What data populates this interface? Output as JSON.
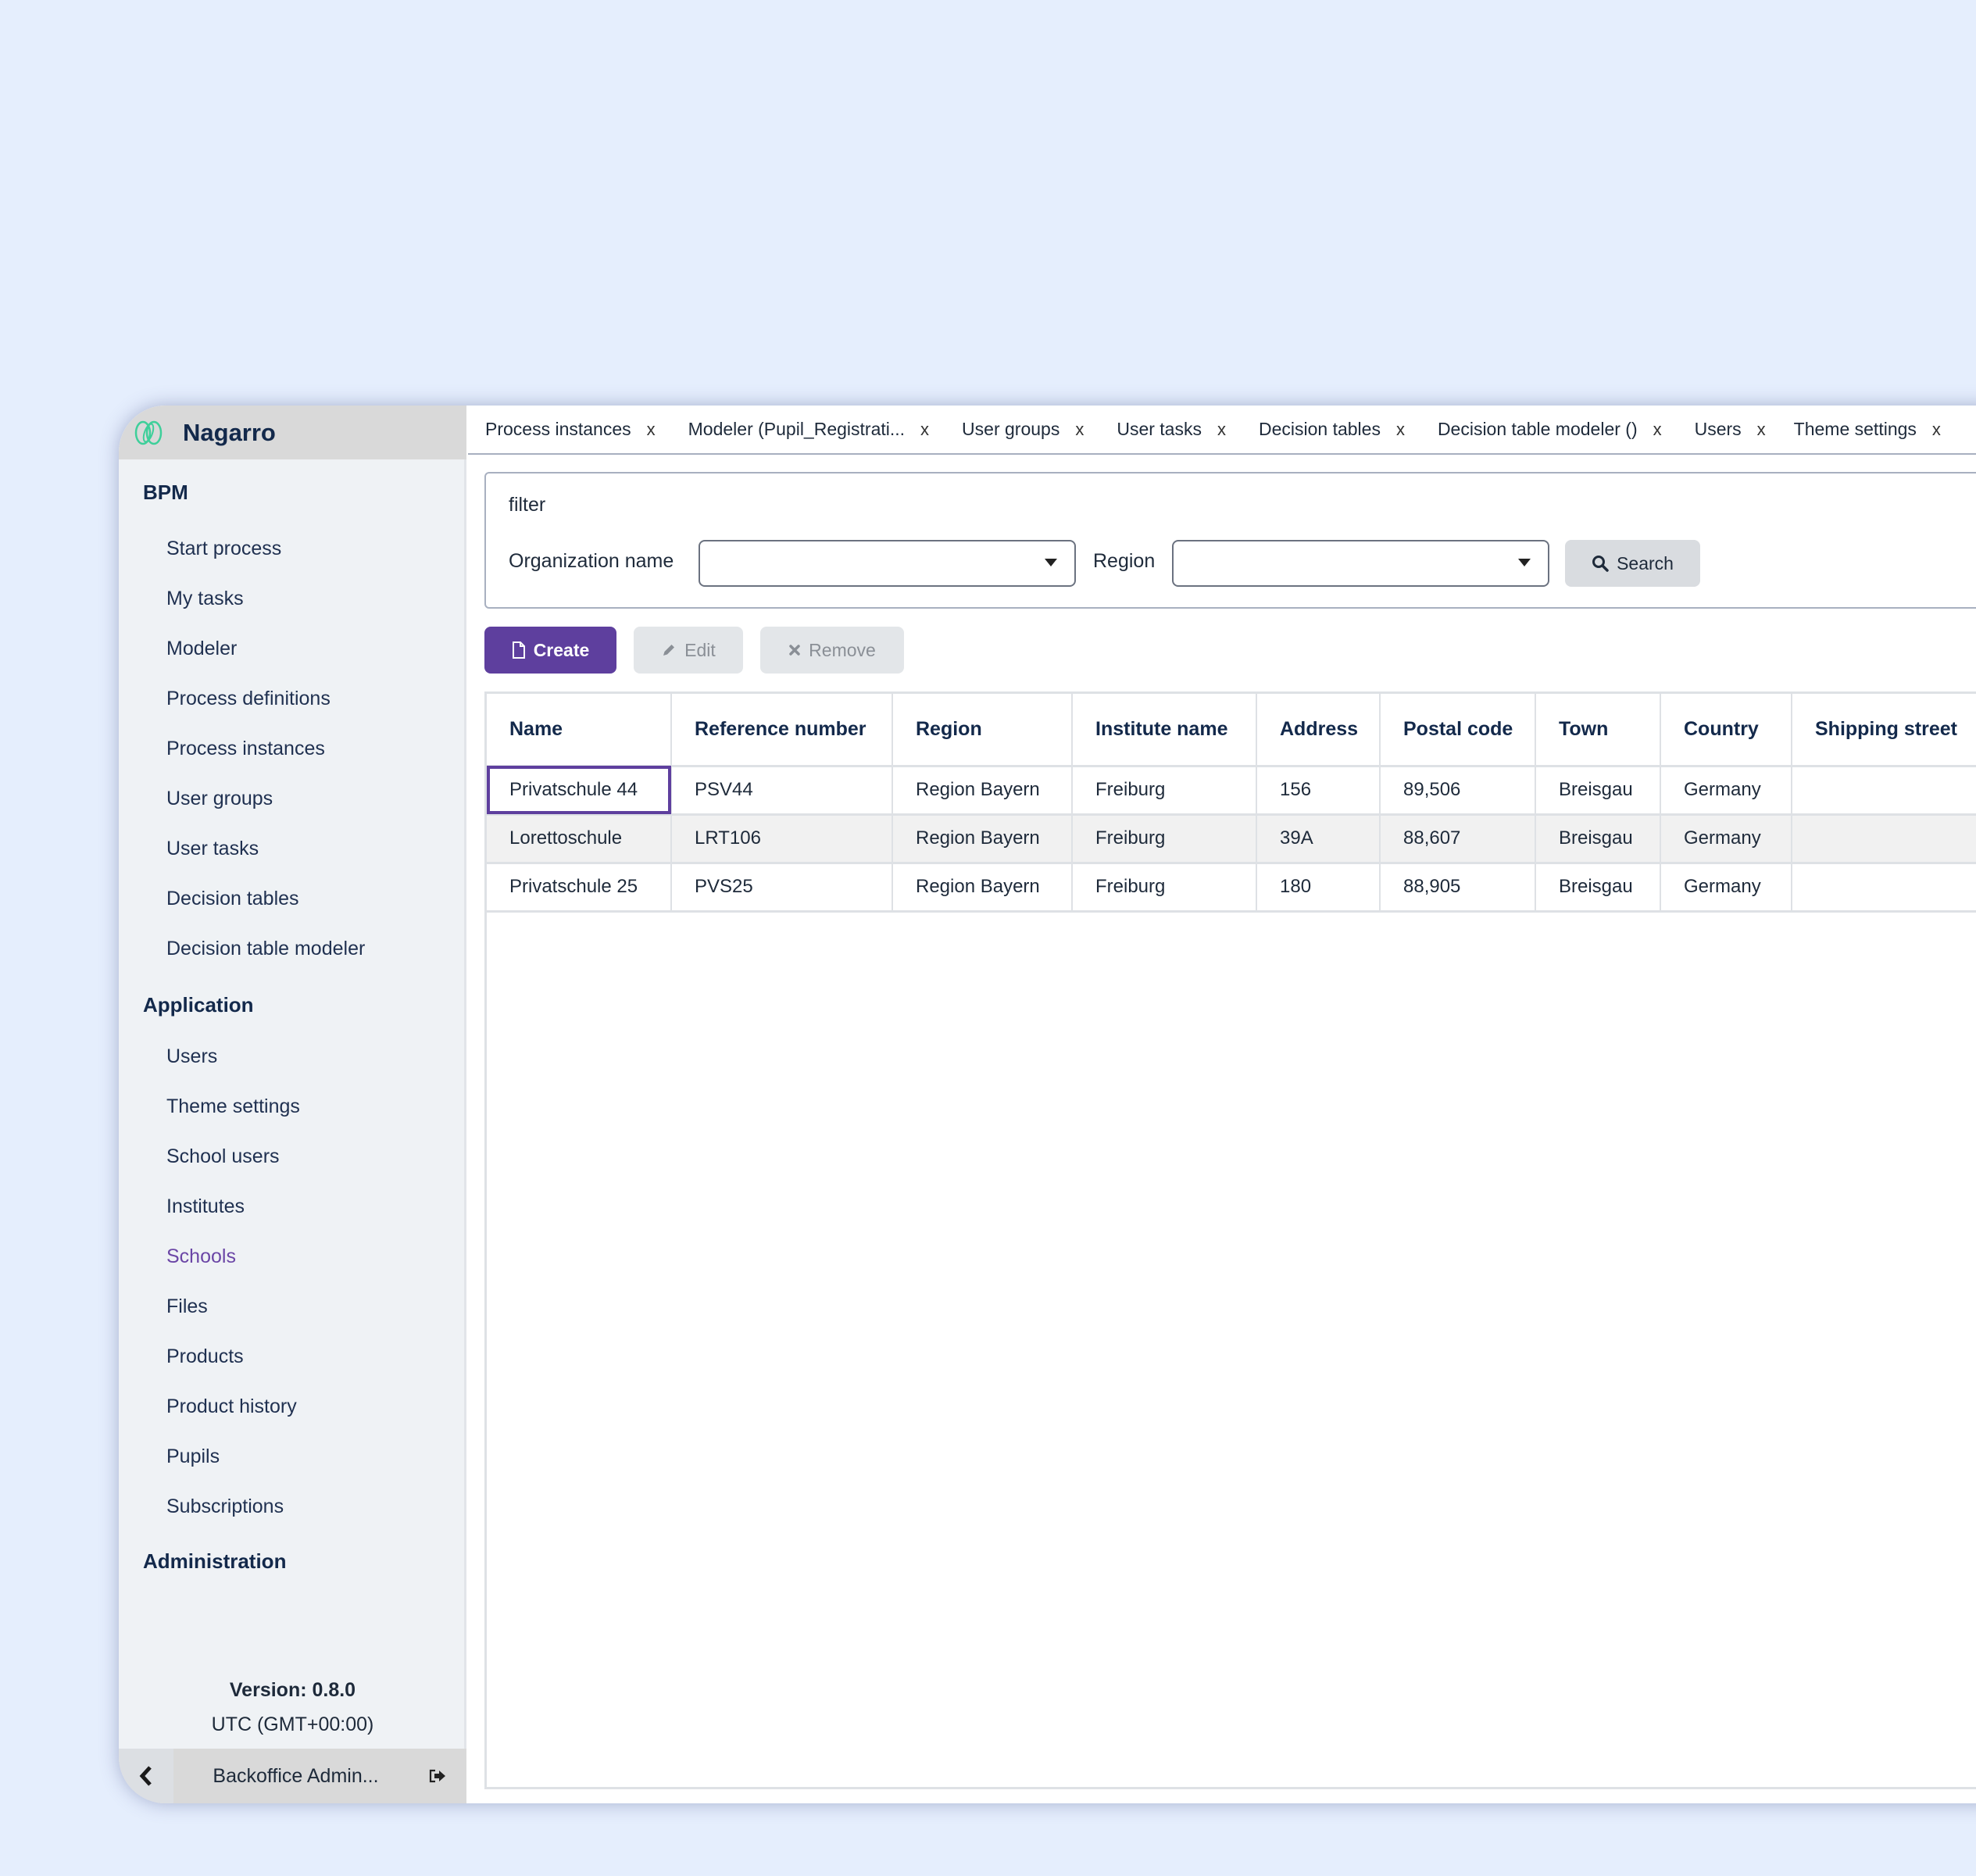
{
  "brand": {
    "name": "Nagarro",
    "accent": "#5e3f9e",
    "logo_color": "#3ecf9a"
  },
  "sidebar": {
    "sections": [
      {
        "title": "BPM",
        "items": [
          {
            "label": "Start process"
          },
          {
            "label": "My tasks"
          },
          {
            "label": "Modeler"
          },
          {
            "label": "Process definitions"
          },
          {
            "label": "Process instances"
          },
          {
            "label": "User groups"
          },
          {
            "label": "User tasks"
          },
          {
            "label": "Decision tables"
          },
          {
            "label": "Decision table modeler"
          }
        ]
      },
      {
        "title": "Application",
        "items": [
          {
            "label": "Users"
          },
          {
            "label": "Theme settings"
          },
          {
            "label": "School users"
          },
          {
            "label": "Institutes"
          },
          {
            "label": "Schools",
            "active": true
          },
          {
            "label": "Files"
          },
          {
            "label": "Products"
          },
          {
            "label": "Product history"
          },
          {
            "label": "Pupils"
          },
          {
            "label": "Subscriptions"
          }
        ]
      },
      {
        "title": "Administration",
        "items": []
      }
    ],
    "version": "Version: 0.8.0",
    "timezone": "UTC (GMT+00:00)",
    "user": "Backoffice Admin..."
  },
  "tabs": [
    {
      "label": "Process instances",
      "close": "x"
    },
    {
      "label": "Modeler (Pupil_Registrati...",
      "close": "x"
    },
    {
      "label": "User groups",
      "close": "x"
    },
    {
      "label": "User tasks",
      "close": "x"
    },
    {
      "label": "Decision tables",
      "close": "x"
    },
    {
      "label": "Decision table modeler ()",
      "close": "x"
    },
    {
      "label": "Users",
      "close": "x"
    },
    {
      "label": "Theme settings",
      "close": "x"
    }
  ],
  "filter": {
    "title": "filter",
    "organization_label": "Organization name",
    "organization_value": "",
    "region_label": "Region",
    "region_value": "",
    "search_label": "Search"
  },
  "toolbar": {
    "create_label": "Create",
    "edit_label": "Edit",
    "remove_label": "Remove"
  },
  "table": {
    "columns": [
      "Name",
      "Reference number",
      "Region",
      "Institute name",
      "Address",
      "Postal code",
      "Town",
      "Country",
      "Shipping street"
    ],
    "rows": [
      [
        "Privatschule 44",
        "PSV44",
        "Region Bayern",
        "Freiburg",
        "156",
        "89,506",
        "Breisgau",
        "Germany",
        ""
      ],
      [
        "Lorettoschule",
        "LRT106",
        "Region Bayern",
        "Freiburg",
        "39A",
        "88,607",
        "Breisgau",
        "Germany",
        ""
      ],
      [
        "Privatschule 25",
        "PVS25",
        "Region Bayern",
        "Freiburg",
        "180",
        "88,905",
        "Breisgau",
        "Germany",
        ""
      ]
    ]
  }
}
